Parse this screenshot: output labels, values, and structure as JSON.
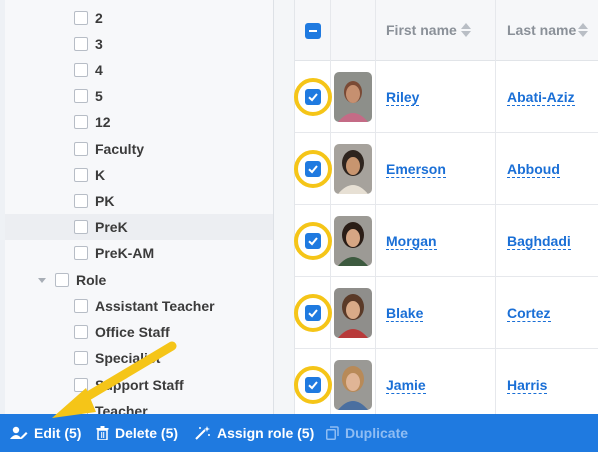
{
  "tree": {
    "items": [
      {
        "label": "2"
      },
      {
        "label": "3"
      },
      {
        "label": "4"
      },
      {
        "label": "5"
      },
      {
        "label": "12"
      },
      {
        "label": "Faculty"
      },
      {
        "label": "K"
      },
      {
        "label": "PK"
      },
      {
        "label": "PreK"
      },
      {
        "label": "PreK-AM"
      }
    ],
    "role_group": {
      "label": "Role",
      "items": [
        {
          "label": "Assistant Teacher"
        },
        {
          "label": "Office Staff"
        },
        {
          "label": "Specialist"
        },
        {
          "label": "Support Staff"
        },
        {
          "label": "Teacher"
        }
      ]
    }
  },
  "table": {
    "columns": {
      "first_name": "First name",
      "last_name": "Last name"
    },
    "rows": [
      {
        "first": "Riley",
        "last": "Abati-Aziz",
        "checked": true
      },
      {
        "first": "Emerson",
        "last": "Abboud",
        "checked": true
      },
      {
        "first": "Morgan",
        "last": "Baghdadi",
        "checked": true
      },
      {
        "first": "Blake",
        "last": "Cortez",
        "checked": true
      },
      {
        "first": "Jamie",
        "last": "Harris",
        "checked": true
      }
    ]
  },
  "actions": {
    "edit": "Edit (5)",
    "delete": "Delete (5)",
    "assign_role": "Assign role (5)",
    "duplicate": "Duplicate"
  },
  "colors": {
    "accent": "#1f7ae0",
    "highlight_ring": "#f5c518",
    "arrow": "#f5c518"
  }
}
